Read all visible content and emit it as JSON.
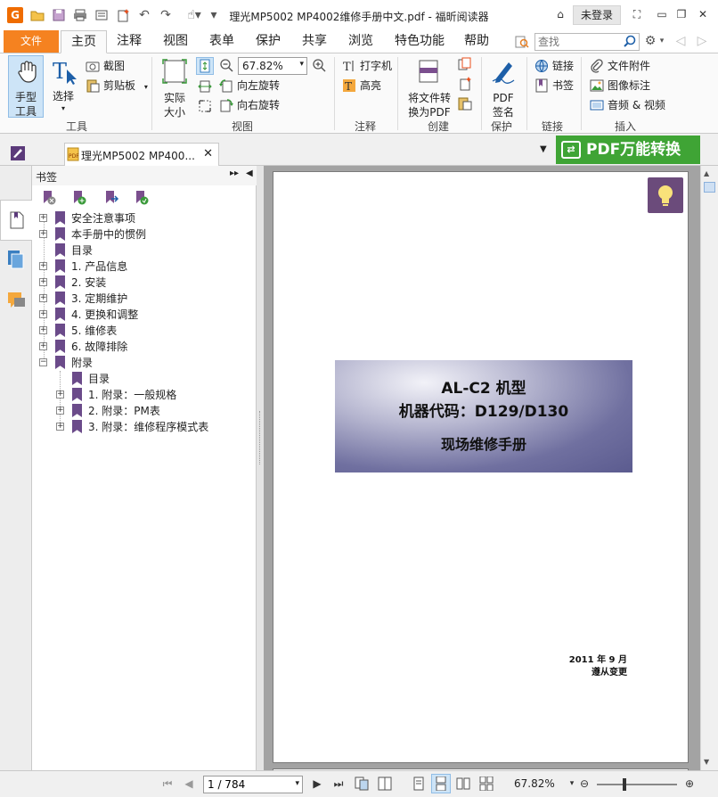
{
  "window": {
    "title": "理光MP5002 MP4002维修手册中文.pdf - 福昕阅读器",
    "login_label": "未登录"
  },
  "menu": {
    "file_label": "文件",
    "tabs": [
      "主页",
      "注释",
      "视图",
      "表单",
      "保护",
      "共享",
      "浏览",
      "特色功能",
      "帮助"
    ],
    "active_tab": "主页",
    "search_placeholder": "查找"
  },
  "ribbon": {
    "tools": {
      "hand_label_1": "手型",
      "hand_label_2": "工具",
      "select_label": "选择",
      "screenshot_label": "截图",
      "clipboard_label": "剪贴板",
      "group_label": "工具"
    },
    "view": {
      "actual_size_1": "实际",
      "actual_size_2": "大小",
      "zoom_value": "67.82%",
      "rotate_left": "向左旋转",
      "rotate_right": "向右旋转",
      "group_label": "视图"
    },
    "annotate": {
      "typewriter": "打字机",
      "highlight": "高亮",
      "group_label": "注释"
    },
    "create": {
      "convert_1": "将文件转",
      "convert_2": "换为PDF",
      "group_label": "创建"
    },
    "protect": {
      "sign_1": "PDF",
      "sign_2": "签名",
      "group_label": "保护"
    },
    "links": {
      "link": "链接",
      "bookmark": "书签",
      "group_label": "链接"
    },
    "insert": {
      "attachment": "文件附件",
      "image_annotation": "图像标注",
      "audio_video": "音频 & 视频",
      "group_label": "插入"
    }
  },
  "doc_tab": {
    "label": "理光MP5002 MP400..."
  },
  "pdf_convert_label": "PDF万能转换",
  "bookmarks": {
    "title": "书签",
    "items": [
      {
        "label": "安全注意事项",
        "level": 0,
        "toggle": "+"
      },
      {
        "label": "本手册中的惯例",
        "level": 0,
        "toggle": "+"
      },
      {
        "label": "目录",
        "level": 0,
        "toggle": ""
      },
      {
        "label": "1. 产品信息",
        "level": 0,
        "toggle": "+"
      },
      {
        "label": "2. 安装",
        "level": 0,
        "toggle": "+"
      },
      {
        "label": "3. 定期维护",
        "level": 0,
        "toggle": "+"
      },
      {
        "label": "4. 更换和调整",
        "level": 0,
        "toggle": "+"
      },
      {
        "label": "5. 维修表",
        "level": 0,
        "toggle": "+"
      },
      {
        "label": "6. 故障排除",
        "level": 0,
        "toggle": "+"
      },
      {
        "label": "附录",
        "level": 0,
        "toggle": "−"
      },
      {
        "label": "目录",
        "level": 1,
        "toggle": ""
      },
      {
        "label": "1. 附录：一般规格",
        "level": 1,
        "toggle": "+"
      },
      {
        "label": "2. 附录：PM表",
        "level": 1,
        "toggle": "+"
      },
      {
        "label": "3. 附录：维修程序模式表",
        "level": 1,
        "toggle": "+"
      }
    ]
  },
  "page": {
    "cover_line1": "AL-C2 机型",
    "cover_line2": "机器代码：D129/D130",
    "cover_line3": "现场维修手册",
    "date": "2011 年 9 月",
    "note": "遵从变更"
  },
  "status": {
    "page_value": "1 / 784",
    "zoom": "67.82%"
  },
  "colors": {
    "accent_orange": "#f58220",
    "convert_green": "#3fa435",
    "bookmark_purple": "#6b4b8a"
  }
}
